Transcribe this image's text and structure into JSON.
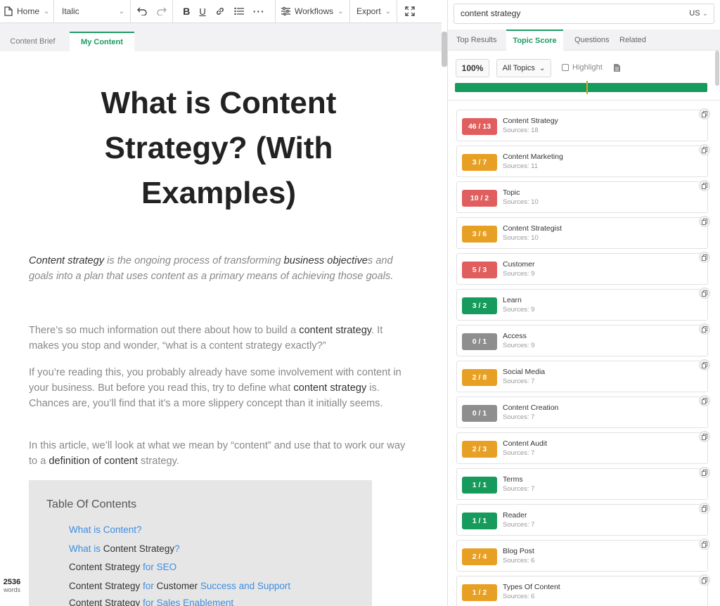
{
  "toolbar": {
    "home_label": "Home",
    "style_label": "Italic",
    "workflows_label": "Workflows",
    "export_label": "Export"
  },
  "editor_tabs": {
    "brief": "Content Brief",
    "mine": "My Content"
  },
  "document": {
    "title": "What is Content Strategy? (With Examples)",
    "intro": {
      "a": "Content strategy",
      "b": " is the ongoing process of transforming ",
      "c": "business objective",
      "d": "s and goals into a plan that uses content as a primary means of achieving those goals."
    },
    "p1": {
      "a": "There’s so much information out there about how to build a ",
      "b": "content strategy",
      "c": ". It makes you stop and wonder, “what is a content strategy exactly?”"
    },
    "p2": {
      "a": "If you’re reading this, you probably already have some involvement with content in your business. But before you read this, try to define what ",
      "b": "content strategy",
      "c": " is. Chances are, you’ll find that it’s a more slippery concept than it initially seems."
    },
    "p3": {
      "a": "In this article, we’ll look at what we mean by “content” and use that to work our way to a ",
      "b": "definition of content",
      "c": " strategy."
    },
    "toc": {
      "title": "Table Of Contents",
      "items": [
        {
          "a": "",
          "b": "What is Content?",
          "c": ""
        },
        {
          "a": "",
          "b": "What is ",
          "c": "Content Strategy",
          "d": "?"
        },
        {
          "a": "Content Strategy",
          "b": " for SEO"
        },
        {
          "a": "Content Strategy",
          "b": " for ",
          "c": "Customer",
          "d": " Success and Support"
        },
        {
          "a": "Content Strategy",
          "b": " for Sales Enablement"
        }
      ]
    },
    "word_count": "2536",
    "word_label": "words"
  },
  "panel": {
    "search_value": "content strategy",
    "country": "US",
    "tabs": [
      "Top Results",
      "Topic Score",
      "Questions",
      "Related"
    ],
    "active_tab": "Topic Score",
    "score": "100%",
    "topics_filter": "All Topics",
    "highlight_label": "Highlight",
    "progress_marker": 0.52,
    "topics": [
      {
        "score": "46 / 13",
        "name": "Content Strategy",
        "sources": "Sources: 18",
        "color": "#e05e5e"
      },
      {
        "score": "3 / 7",
        "name": "Content Marketing",
        "sources": "Sources: 11",
        "color": "#e8a024"
      },
      {
        "score": "10 / 2",
        "name": "Topic",
        "sources": "Sources: 10",
        "color": "#e05e5e"
      },
      {
        "score": "3 / 6",
        "name": "Content Strategist",
        "sources": "Sources: 10",
        "color": "#e8a024"
      },
      {
        "score": "5 / 3",
        "name": "Customer",
        "sources": "Sources: 9",
        "color": "#e05e5e"
      },
      {
        "score": "3 / 2",
        "name": "Learn",
        "sources": "Sources: 9",
        "color": "#179b5c"
      },
      {
        "score": "0 / 1",
        "name": "Access",
        "sources": "Sources: 9",
        "color": "#8e8e8e"
      },
      {
        "score": "2 / 8",
        "name": "Social Media",
        "sources": "Sources: 7",
        "color": "#e8a024"
      },
      {
        "score": "0 / 1",
        "name": "Content Creation",
        "sources": "Sources: 7",
        "color": "#8e8e8e"
      },
      {
        "score": "2 / 3",
        "name": "Content Audit",
        "sources": "Sources: 7",
        "color": "#e8a024"
      },
      {
        "score": "1 / 1",
        "name": "Terms",
        "sources": "Sources: 7",
        "color": "#179b5c"
      },
      {
        "score": "1 / 1",
        "name": "Reader",
        "sources": "Sources: 7",
        "color": "#179b5c"
      },
      {
        "score": "2 / 4",
        "name": "Blog Post",
        "sources": "Sources: 6",
        "color": "#e8a024"
      },
      {
        "score": "1 / 2",
        "name": "Types Of Content",
        "sources": "Sources: 6",
        "color": "#e8a024"
      }
    ]
  }
}
